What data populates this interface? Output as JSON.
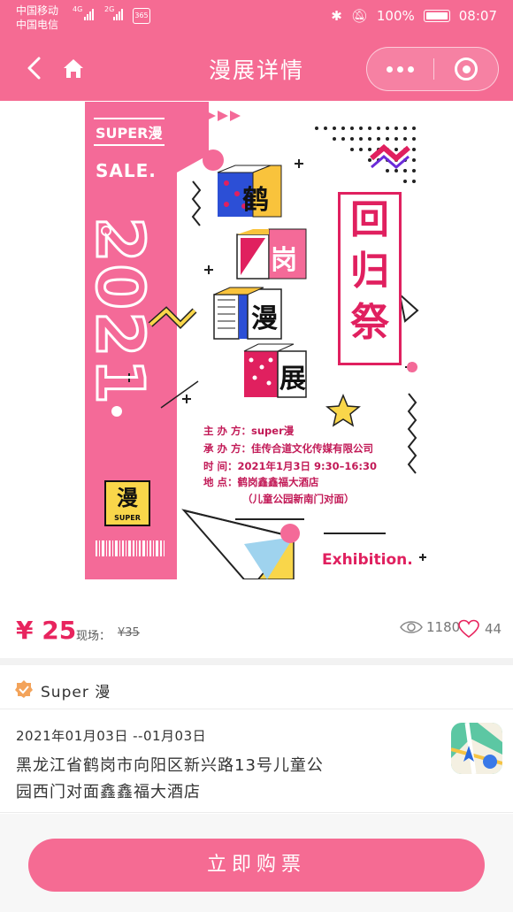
{
  "status_bar": {
    "carrier_1": "中国移动",
    "carrier_2": "中国电信",
    "net_1": "4G",
    "net_2": "2G",
    "badge": "365",
    "battery": "100%",
    "time": "08:07"
  },
  "nav": {
    "title": "漫展详情"
  },
  "poster": {
    "brand": "SUPER漫",
    "sale": "SALE.",
    "year": "2021",
    "cube_chars": [
      "鹤",
      "岗",
      "漫",
      "展"
    ],
    "title_chars": [
      "回",
      "归",
      "祭"
    ],
    "info": [
      "主 办 方：super漫",
      "承 办 方：佳传合道文化传媒有限公司",
      "时     间：2021年1月3日 9:30–16:30",
      "地     点：鹤岗鑫鑫福大酒店",
      "（儿童公园新南门对面）"
    ],
    "logo_char": "漫",
    "logo_sub": "SUPER",
    "exhibition": "Exhibition."
  },
  "price": {
    "value": "¥ 25",
    "onsite_label": "现场：",
    "onsite_value": "¥35"
  },
  "stats": {
    "views": "1180",
    "likes": "44"
  },
  "organizer": {
    "name": "Super 漫"
  },
  "event": {
    "date": "2021年01月03日 --01月03日",
    "address": "黑龙江省鹤岗市向阳区新兴路13号儿童公园西门对面鑫鑫福大酒店"
  },
  "buy_button": {
    "label": "立即购票"
  },
  "colors": {
    "brand": "#f56b93",
    "price": "#e8245e"
  }
}
